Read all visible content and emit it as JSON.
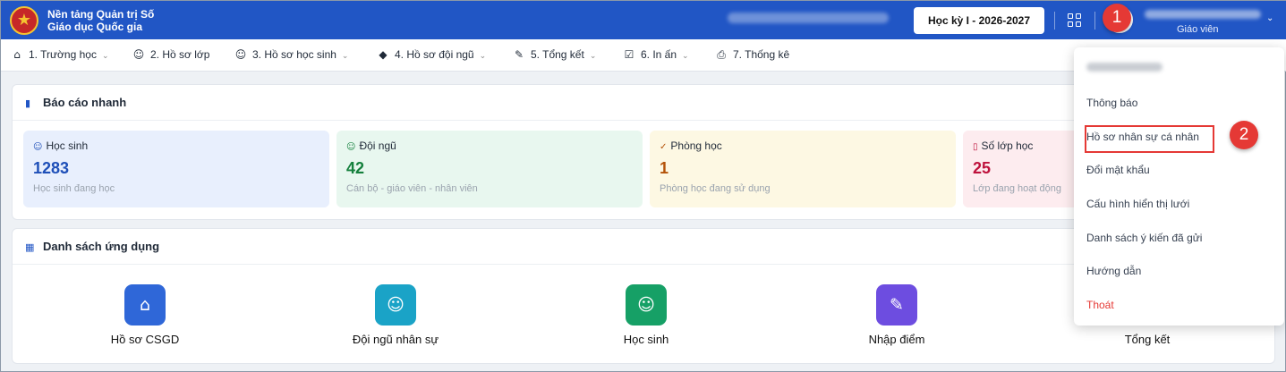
{
  "header": {
    "brand_line1": "Nền tảng Quản trị Số",
    "brand_line2": "Giáo dục Quốc gia",
    "semester": "Học kỳ I - 2026-2027",
    "role": "Giáo viên",
    "brand_color": "#2156c5"
  },
  "nav": {
    "items": [
      {
        "label": "1. Trường học",
        "icon": "building-icon"
      },
      {
        "label": "2. Hồ sơ lớp",
        "icon": "user-icon"
      },
      {
        "label": "3. Hồ sơ học sinh",
        "icon": "users-icon"
      },
      {
        "label": "4. Hồ sơ đội ngũ",
        "icon": "graduation-cap-icon"
      },
      {
        "label": "5. Tổng kết",
        "icon": "pencil-icon"
      },
      {
        "label": "6. In ấn",
        "icon": "checkbox-icon"
      },
      {
        "label": "7. Thống kê",
        "icon": "printer-icon"
      }
    ]
  },
  "quick_report": {
    "title": "Báo cáo nhanh",
    "cards": [
      {
        "label": "Học sinh",
        "value": "1283",
        "desc": "Học sinh đang học",
        "bg": "#e8effd",
        "color": "#1e4fb8"
      },
      {
        "label": "Đội ngũ",
        "value": "42",
        "desc": "Cán bộ - giáo viên - nhân viên",
        "bg": "#e8f7ef",
        "color": "#15803d"
      },
      {
        "label": "Phòng học",
        "value": "1",
        "desc": "Phòng học đang sử dụng",
        "bg": "#fdf8e3",
        "color": "#b45309"
      },
      {
        "label": "Số lớp học",
        "value": "25",
        "desc": "Lớp đang hoạt động",
        "bg": "#fdecef",
        "color": "#be123c"
      }
    ]
  },
  "apps": {
    "title": "Danh sách ứng dụng",
    "items": [
      {
        "label": "Hồ sơ CSGD",
        "icon": "home-icon",
        "color": "#2f67d8"
      },
      {
        "label": "Đội ngũ nhân sự",
        "icon": "users-icon",
        "color": "#1aa3c7"
      },
      {
        "label": "Học sinh",
        "icon": "user-icon",
        "color": "#16a066"
      },
      {
        "label": "Nhập điểm",
        "icon": "edit-icon",
        "color": "#6d4de0"
      },
      {
        "label": "Tổng kết",
        "icon": "chart-icon",
        "color": "#f08a24"
      }
    ]
  },
  "user_menu": {
    "items": [
      "Thông báo",
      "Hồ sơ nhân sự cá nhân",
      "Đổi mật khẩu",
      "Cấu hình hiển thị lưới",
      "Danh sách ý kiến đã gửi",
      "Hướng dẫn"
    ],
    "logout": "Thoát"
  },
  "annotations": {
    "step1": "1",
    "step2": "2",
    "highlight_color": "#e53935"
  }
}
